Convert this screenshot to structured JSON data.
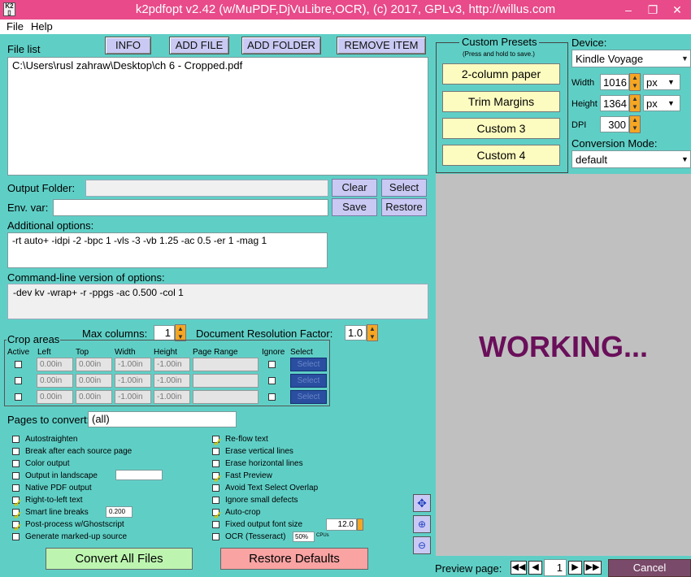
{
  "window": {
    "title": "k2pdfopt v2.42 (w/MuPDF,DjVuLibre,OCR), (c) 2017, GPLv3, http://willus.com",
    "min": "–",
    "restore": "❐",
    "close": "✕"
  },
  "menu": {
    "file": "File",
    "help": "Help"
  },
  "filelist": {
    "label": "File list",
    "info": "INFO",
    "add_file": "ADD FILE",
    "add_folder": "ADD FOLDER",
    "remove": "REMOVE ITEM",
    "items": [
      "C:\\Users\\rusl zahraw\\Desktop\\ch 6 - Cropped.pdf"
    ]
  },
  "output": {
    "label": "Output Folder:",
    "value": "",
    "clear": "Clear",
    "select": "Select"
  },
  "env": {
    "label": "Env. var:",
    "value": "",
    "save": "Save",
    "restore": "Restore"
  },
  "additional": {
    "label": "Additional options:",
    "value": "-rt auto+ -idpi -2 -bpc 1 -vls -3 -vb 1.25 -ac 0.5  -er 1 -mag 1"
  },
  "cmdline": {
    "label": "Command-line version of options:",
    "value": "-dev kv -wrap+ -r -ppgs -ac 0.500 -col 1"
  },
  "maxcol": {
    "label": "Max columns:",
    "value": "1"
  },
  "docres": {
    "label": "Document Resolution Factor:",
    "value": "1.0"
  },
  "crop": {
    "title": "Crop areas",
    "headers": [
      "Active",
      "Left",
      "Top",
      "Width",
      "Height",
      "Page Range",
      "Ignore",
      "Select"
    ],
    "rows": [
      {
        "left": "0.00in",
        "top": "0.00in",
        "width": "-1.00in",
        "height": "-1.00in",
        "range": "",
        "select": "Select"
      },
      {
        "left": "0.00in",
        "top": "0.00in",
        "width": "-1.00in",
        "height": "-1.00in",
        "range": "",
        "select": "Select"
      },
      {
        "left": "0.00in",
        "top": "0.00in",
        "width": "-1.00in",
        "height": "-1.00in",
        "range": "",
        "select": "Select"
      }
    ]
  },
  "pages": {
    "label": "Pages to convert:",
    "value": "(all)"
  },
  "options_left": [
    {
      "label": "Autostraighten",
      "checked": false
    },
    {
      "label": "Break after each source page",
      "checked": false
    },
    {
      "label": "Color output",
      "checked": false
    },
    {
      "label": "Output in landscape",
      "checked": false
    },
    {
      "label": "Native PDF output",
      "checked": false
    },
    {
      "label": "Right-to-left text",
      "checked": true
    },
    {
      "label": "Smart line breaks",
      "checked": true
    },
    {
      "label": "Post-process w/Ghostscript",
      "checked": true
    },
    {
      "label": "Generate marked-up source",
      "checked": false
    }
  ],
  "smart_value": "0.200",
  "options_right": [
    {
      "label": "Re-flow text",
      "checked": true
    },
    {
      "label": "Erase vertical lines",
      "checked": false
    },
    {
      "label": "Erase horizontal lines",
      "checked": false
    },
    {
      "label": "Fast Preview",
      "checked": true
    },
    {
      "label": "Avoid Text Select Overlap",
      "checked": false
    },
    {
      "label": "Ignore small defects",
      "checked": false
    },
    {
      "label": "Auto-crop",
      "checked": true
    },
    {
      "label": "Fixed output font size",
      "checked": false
    },
    {
      "label": "OCR (Tesseract)",
      "checked": false
    }
  ],
  "font_size_value": "12.0",
  "ocr_pct": "50%",
  "ocr_unit": "CPUs",
  "convert": "Convert All Files",
  "restore_defaults": "Restore Defaults",
  "presets": {
    "title": "Custom Presets",
    "subtitle": "(Press and hold to save.)",
    "items": [
      "2-column paper",
      "Trim Margins",
      "Custom 3",
      "Custom 4"
    ]
  },
  "device": {
    "label": "Device:",
    "value": "Kindle Voyage",
    "width_label": "Width",
    "width": "1016",
    "width_unit": "px",
    "height_label": "Height",
    "height": "1364",
    "height_unit": "px",
    "dpi_label": "DPI",
    "dpi": "300"
  },
  "conversion": {
    "label": "Conversion Mode:",
    "value": "default"
  },
  "preview": {
    "status": "WORKING...",
    "label": "Preview page:",
    "page": "1",
    "cancel": "Cancel"
  },
  "colors": {
    "title_bar": "#e84a8a",
    "working": "#6a0f5a",
    "background": "#5fcfc6"
  }
}
